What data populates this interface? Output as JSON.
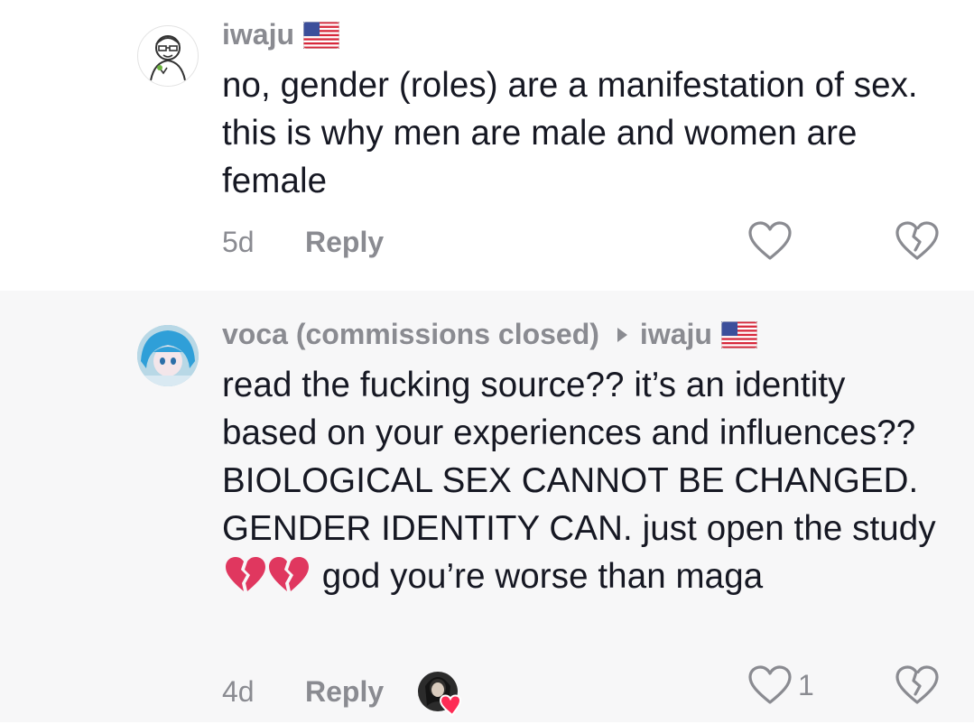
{
  "comments": [
    {
      "username": "iwaju",
      "flag_icon": "us-flag-icon",
      "text": "no, gender (roles) are a manifestation of sex. this is why men are male and women are female",
      "time": "5d",
      "reply_label": "Reply",
      "like_count": ""
    },
    {
      "username": "voca (commissions closed)",
      "reply_to": "iwaju",
      "flag_icon": "us-flag-icon",
      "text_before_emoji": "read the fucking source?? it’s an identity based on your experiences and influences?? BIOLOGICAL SEX CANNOT BE CHANGED. GENDER IDENTITY CAN. just open the study",
      "emoji": "broken-heart-icon",
      "text_after_emoji": "god you’re worse than maga",
      "time": "4d",
      "reply_label": "Reply",
      "liked_by_creator": true,
      "like_count": "1"
    }
  ],
  "colors": {
    "secondary_text": "#8a8b91",
    "primary_text": "#161823",
    "alt_background": "#f7f7f8",
    "heart_badge": "#fe2c55"
  }
}
